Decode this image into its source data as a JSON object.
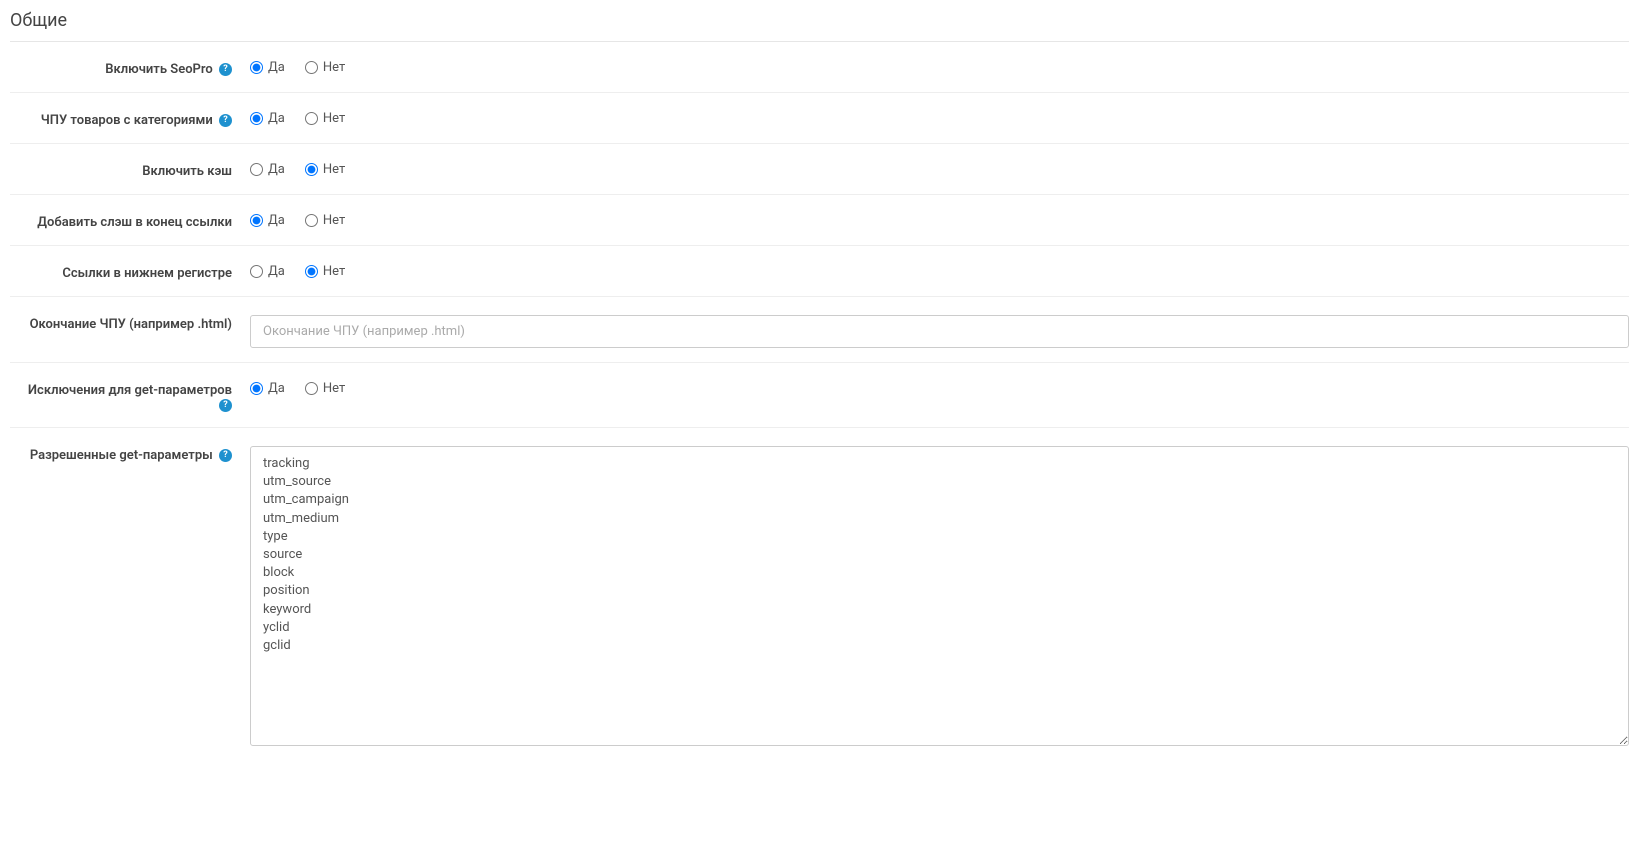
{
  "section_title": "Общие",
  "yes_label": "Да",
  "no_label": "Нет",
  "fields": {
    "enable_seopro": {
      "label": "Включить SeoPro",
      "help": true,
      "value": "yes"
    },
    "seo_categories": {
      "label": "ЧПУ товаров с категориями",
      "help": true,
      "value": "yes"
    },
    "enable_cache": {
      "label": "Включить кэш",
      "help": false,
      "value": "no"
    },
    "trailing_slash": {
      "label": "Добавить слэш в конец ссылки",
      "help": false,
      "value": "yes"
    },
    "lowercase_links": {
      "label": "Ссылки в нижнем регистре",
      "help": false,
      "value": "no"
    },
    "seo_ending": {
      "label": "Окончание ЧПУ (например .html)",
      "placeholder": "Окончание ЧПУ (например .html)",
      "value": ""
    },
    "get_exceptions": {
      "label": "Исключения для get-параметров",
      "help": true,
      "value": "yes"
    },
    "allowed_get": {
      "label": "Разрешенные get-параметры",
      "help": true,
      "value": "tracking\nutm_source\nutm_campaign\nutm_medium\ntype\nsource\nblock\nposition\nkeyword\nyclid\ngclid"
    }
  }
}
